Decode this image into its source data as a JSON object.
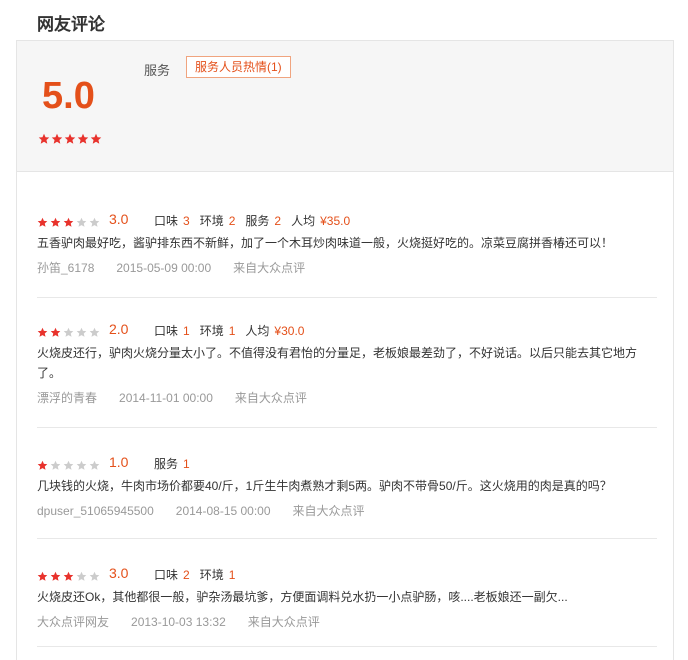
{
  "section_title": "网友评论",
  "summary": {
    "score": "5.0",
    "stars": 5,
    "tag_label": "服务",
    "tag": "服务人员热情(1)"
  },
  "colors": {
    "accent": "#e4501a",
    "star_on": "#e8322c",
    "star_off": "#cccccc"
  },
  "reviews": [
    {
      "stars": 3,
      "score": "3.0",
      "dims": [
        {
          "label": "口味",
          "value": "3"
        },
        {
          "label": "环境",
          "value": "2"
        },
        {
          "label": "服务",
          "value": "2"
        },
        {
          "label": "人均",
          "value": "¥35.0"
        }
      ],
      "text": "五香驴肉最好吃，酱驴排东西不新鲜，加了一个木耳炒肉味道一般，火烧挺好吃的。凉菜豆腐拼香椿还可以！",
      "user": "孙笛_6178",
      "date": "2015-05-09 00:00",
      "source": "来自大众点评"
    },
    {
      "stars": 2,
      "score": "2.0",
      "dims": [
        {
          "label": "口味",
          "value": "1"
        },
        {
          "label": "环境",
          "value": "1"
        },
        {
          "label": "人均",
          "value": "¥30.0"
        }
      ],
      "text": "火烧皮还行，驴肉火烧分量太小了。不值得没有君怡的分量足，老板娘最差劲了，不好说话。以后只能去其它地方了。",
      "user": "漂浮的青春",
      "date": "2014-11-01 00:00",
      "source": "来自大众点评"
    },
    {
      "stars": 1,
      "score": "1.0",
      "dims": [
        {
          "label": "服务",
          "value": "1"
        }
      ],
      "text": "几块钱的火烧，牛肉市场价都要40/斤，1斤生牛肉煮熟才剩5两。驴肉不带骨50/斤。这火烧用的肉是真的吗？",
      "user": "dpuser_51065945500",
      "date": "2014-08-15 00:00",
      "source": "来自大众点评"
    },
    {
      "stars": 3,
      "score": "3.0",
      "dims": [
        {
          "label": "口味",
          "value": "2"
        },
        {
          "label": "环境",
          "value": "1"
        }
      ],
      "text": "火烧皮还Ok，其他都很一般，驴杂汤最坑爹，方便面调料兑水扔一小点驴肠，咳....老板娘还一副欠...",
      "user": "大众点评网友",
      "date": "2013-10-03 13:32",
      "source": "来自大众点评"
    }
  ]
}
